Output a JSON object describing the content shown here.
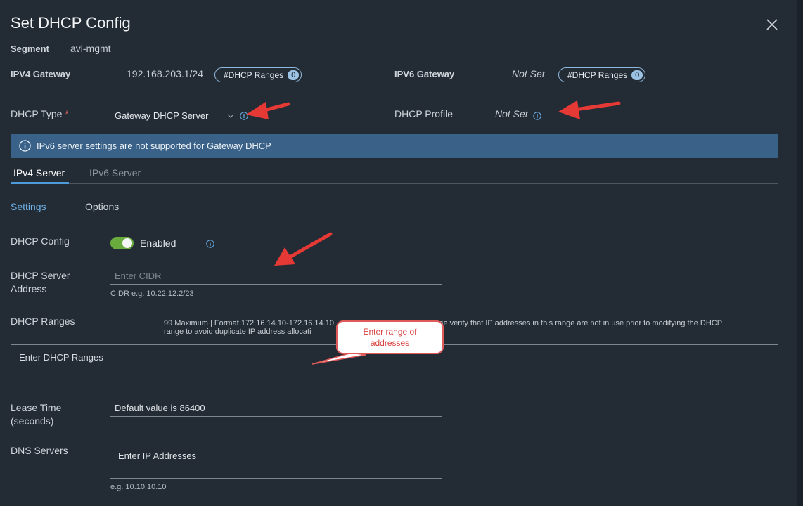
{
  "dialog": {
    "title": "Set DHCP Config",
    "close_icon": "close-icon"
  },
  "segment": {
    "label": "Segment",
    "value": "avi-mgmt"
  },
  "ipv4_gateway": {
    "label": "IPV4 Gateway",
    "value": "192.168.203.1/24",
    "badge_label": "#DHCP Ranges",
    "badge_count": "0"
  },
  "ipv6_gateway": {
    "label": "IPV6 Gateway",
    "value": "Not Set",
    "badge_label": "#DHCP Ranges",
    "badge_count": "0"
  },
  "dhcp_type": {
    "label": "DHCP Type",
    "required_mark": "*",
    "selected": "Gateway DHCP Server",
    "icon": "info-icon"
  },
  "dhcp_profile": {
    "label": "DHCP Profile",
    "value": "Not Set",
    "icon": "info-icon"
  },
  "banner": {
    "icon": "info-icon",
    "text": "IPv6 server settings are not supported for Gateway DHCP"
  },
  "server_tabs": [
    {
      "label": "IPv4 Server"
    },
    {
      "label": "IPv6 Server"
    }
  ],
  "sub_tabs": [
    {
      "label": "Settings"
    },
    {
      "label": "Options"
    }
  ],
  "dhcp_config": {
    "label": "DHCP Config",
    "toggle_state": "Enabled",
    "icon": "info-icon"
  },
  "dhcp_server_address": {
    "label_line1": "DHCP Server",
    "label_line2": "Address",
    "placeholder": "Enter CIDR",
    "hint": "CIDR e.g. 10.22.12.2/23"
  },
  "dhcp_ranges": {
    "label": "DHCP Ranges",
    "hint_line1": "99 Maximum | Format 172.16.14.10-172.16.14.10",
    "hint_line1_tail": "se verify that IP addresses in this range are not in use prior to modifying the DHCP",
    "hint_line2": "range to avoid duplicate IP address allocati",
    "placeholder": "Enter DHCP Ranges"
  },
  "callout": {
    "line1": "Enter range of",
    "line2": "addresses"
  },
  "lease_time": {
    "label_line1": "Lease Time",
    "label_line2": "(seconds)",
    "placeholder": "Default value is 86400"
  },
  "dns_servers": {
    "label": "DNS Servers",
    "placeholder": "Enter IP Addresses",
    "hint": "e.g. 10.10.10.10"
  },
  "colors": {
    "accent": "#4d9bd8",
    "banner": "#3a6288",
    "toggle_on": "#6aab3e",
    "annotation_arrow": "#e53935"
  }
}
